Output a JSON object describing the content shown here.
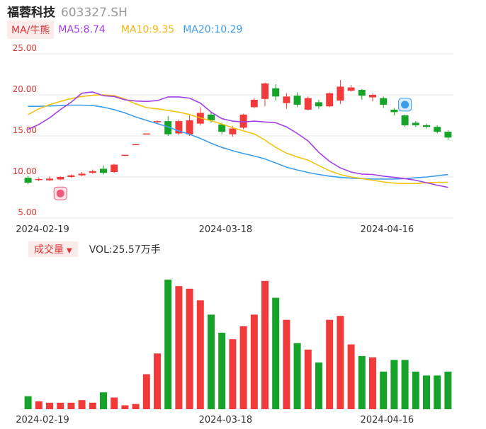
{
  "header": {
    "name": "福蓉科技",
    "code": "603327.SH"
  },
  "ma_legend": {
    "toggle": "MA/牛熊",
    "ma5": "MA5:8.74",
    "ma10": "MA10:9.35",
    "ma20": "MA20:10.29"
  },
  "volume_legend": {
    "toggle": "成交量",
    "vol": "VOL:25.57万手"
  },
  "colors": {
    "up": "#f23a3a",
    "down": "#16a32a",
    "ma5": "#a33ee8",
    "ma10": "#f2c30f",
    "ma20": "#3d9ded",
    "grid": "#e8e8e8"
  },
  "icons": {
    "bull_marker": "bull-icon",
    "bear_marker": "bear-icon"
  },
  "chart_data": [
    {
      "type": "candlestick",
      "yticks": [
        "25.00",
        "20.00",
        "15.00",
        "10.00",
        "5.00"
      ],
      "ylim": [
        5,
        25
      ],
      "xticks": [
        {
          "index": 2,
          "label": "2024-02-19"
        },
        {
          "index": 19,
          "label": "2024-03-18"
        },
        {
          "index": 34,
          "label": "2024-04-16"
        }
      ],
      "markers": [
        {
          "index": 3,
          "value": 8.0,
          "icon": "bull"
        },
        {
          "index": 35,
          "value": 18.8,
          "icon": "bear"
        }
      ],
      "candles": [
        {
          "o": 9.9,
          "c": 9.3,
          "h": 10.1,
          "l": 9.1
        },
        {
          "o": 9.7,
          "c": 9.75,
          "h": 9.95,
          "l": 9.5
        },
        {
          "o": 9.6,
          "c": 9.8,
          "h": 10.1,
          "l": 9.5
        },
        {
          "o": 9.7,
          "c": 10.0,
          "h": 10.1,
          "l": 9.6
        },
        {
          "o": 10.0,
          "c": 10.2,
          "h": 10.3,
          "l": 9.9
        },
        {
          "o": 10.2,
          "c": 10.4,
          "h": 10.6,
          "l": 10.1
        },
        {
          "o": 10.5,
          "c": 10.7,
          "h": 10.9,
          "l": 10.4
        },
        {
          "o": 11.0,
          "c": 10.5,
          "h": 11.4,
          "l": 10.3
        },
        {
          "o": 10.6,
          "c": 11.5,
          "h": 11.6,
          "l": 10.5
        },
        {
          "o": 12.7,
          "c": 12.7,
          "h": 12.7,
          "l": 12.7
        },
        {
          "o": 14.0,
          "c": 14.0,
          "h": 14.0,
          "l": 14.0
        },
        {
          "o": 15.3,
          "c": 15.3,
          "h": 15.3,
          "l": 15.3
        },
        {
          "o": 16.7,
          "c": 16.8,
          "h": 16.9,
          "l": 16.5
        },
        {
          "o": 16.8,
          "c": 15.2,
          "h": 17.4,
          "l": 15.0
        },
        {
          "o": 15.3,
          "c": 16.8,
          "h": 17.0,
          "l": 15.1
        },
        {
          "o": 15.2,
          "c": 16.9,
          "h": 17.5,
          "l": 15.0
        },
        {
          "o": 16.5,
          "c": 17.8,
          "h": 18.5,
          "l": 16.3
        },
        {
          "o": 17.6,
          "c": 16.9,
          "h": 17.9,
          "l": 16.6
        },
        {
          "o": 16.4,
          "c": 15.5,
          "h": 16.6,
          "l": 15.2
        },
        {
          "o": 15.2,
          "c": 15.9,
          "h": 16.2,
          "l": 14.9
        },
        {
          "o": 16.0,
          "c": 17.6,
          "h": 17.7,
          "l": 15.8
        },
        {
          "o": 18.5,
          "c": 19.4,
          "h": 19.6,
          "l": 18.4
        },
        {
          "o": 19.5,
          "c": 21.4,
          "h": 21.5,
          "l": 18.6
        },
        {
          "o": 20.8,
          "c": 19.8,
          "h": 21.3,
          "l": 19.3
        },
        {
          "o": 19.0,
          "c": 19.8,
          "h": 20.2,
          "l": 18.3
        },
        {
          "o": 19.9,
          "c": 18.8,
          "h": 20.3,
          "l": 18.5
        },
        {
          "o": 18.2,
          "c": 19.6,
          "h": 19.8,
          "l": 18.1
        },
        {
          "o": 19.1,
          "c": 18.6,
          "h": 19.4,
          "l": 18.3
        },
        {
          "o": 18.6,
          "c": 20.2,
          "h": 20.3,
          "l": 18.5
        },
        {
          "o": 19.3,
          "c": 21.0,
          "h": 21.8,
          "l": 18.9
        },
        {
          "o": 20.5,
          "c": 20.9,
          "h": 21.2,
          "l": 20.4
        },
        {
          "o": 20.6,
          "c": 19.9,
          "h": 20.7,
          "l": 19.4
        },
        {
          "o": 19.7,
          "c": 20.0,
          "h": 20.2,
          "l": 19.2
        },
        {
          "o": 19.6,
          "c": 18.8,
          "h": 19.8,
          "l": 18.4
        },
        {
          "o": 18.2,
          "c": 17.9,
          "h": 18.4,
          "l": 17.5
        },
        {
          "o": 17.5,
          "c": 16.3,
          "h": 17.6,
          "l": 16.1
        },
        {
          "o": 16.6,
          "c": 16.3,
          "h": 16.8,
          "l": 16.1
        },
        {
          "o": 16.3,
          "c": 16.1,
          "h": 16.5,
          "l": 15.9
        },
        {
          "o": 16.1,
          "c": 15.5,
          "h": 16.3,
          "l": 15.3
        },
        {
          "o": 15.5,
          "c": 14.8,
          "h": 15.7,
          "l": 14.5
        }
      ],
      "ma5": [
        15.8,
        16.4,
        17.2,
        18.2,
        19.1,
        20.2,
        20.35,
        19.9,
        19.8,
        19.4,
        19.25,
        19.2,
        19.3,
        19.75,
        19.75,
        19.6,
        19.0,
        17.9,
        17.1,
        16.8,
        16.7,
        16.8,
        16.7,
        16.6,
        16.1,
        15.3,
        14.4,
        13.0,
        11.9,
        11.1,
        10.6,
        10.35,
        10.3,
        10.1,
        9.95,
        9.8,
        9.6,
        9.3,
        9.0,
        8.74
      ],
      "ma10": [
        17.6,
        18.3,
        18.8,
        19.2,
        19.55,
        19.8,
        19.95,
        20.0,
        19.9,
        19.5,
        18.9,
        18.45,
        18.3,
        18.1,
        17.9,
        17.6,
        17.2,
        16.85,
        16.45,
        16.0,
        15.6,
        15.25,
        14.5,
        13.6,
        12.9,
        12.45,
        12.05,
        11.4,
        10.75,
        10.3,
        10.0,
        9.8,
        9.6,
        9.4,
        9.25,
        9.2,
        9.2,
        9.3,
        9.35,
        9.35
      ],
      "ma20": [
        18.6,
        18.6,
        18.65,
        18.7,
        18.75,
        18.75,
        18.7,
        18.5,
        18.2,
        17.8,
        17.3,
        16.9,
        16.5,
        16.1,
        15.6,
        15.2,
        14.7,
        14.1,
        13.6,
        13.2,
        12.85,
        12.55,
        12.2,
        11.7,
        11.2,
        10.85,
        10.55,
        10.3,
        10.1,
        9.95,
        9.85,
        9.8,
        9.75,
        9.75,
        9.75,
        9.8,
        9.9,
        10.0,
        10.15,
        10.29
      ]
    },
    {
      "type": "bar",
      "ylim": [
        0,
        100
      ],
      "volumes": [
        10,
        6,
        5,
        5,
        5,
        7,
        5,
        13,
        9,
        3,
        4,
        27,
        43,
        100,
        95,
        93,
        84,
        73,
        59,
        54,
        64,
        73,
        99,
        86,
        69,
        51,
        46,
        36,
        69,
        72,
        50,
        41,
        40,
        29,
        38,
        38,
        29,
        26,
        26,
        29
      ]
    }
  ]
}
